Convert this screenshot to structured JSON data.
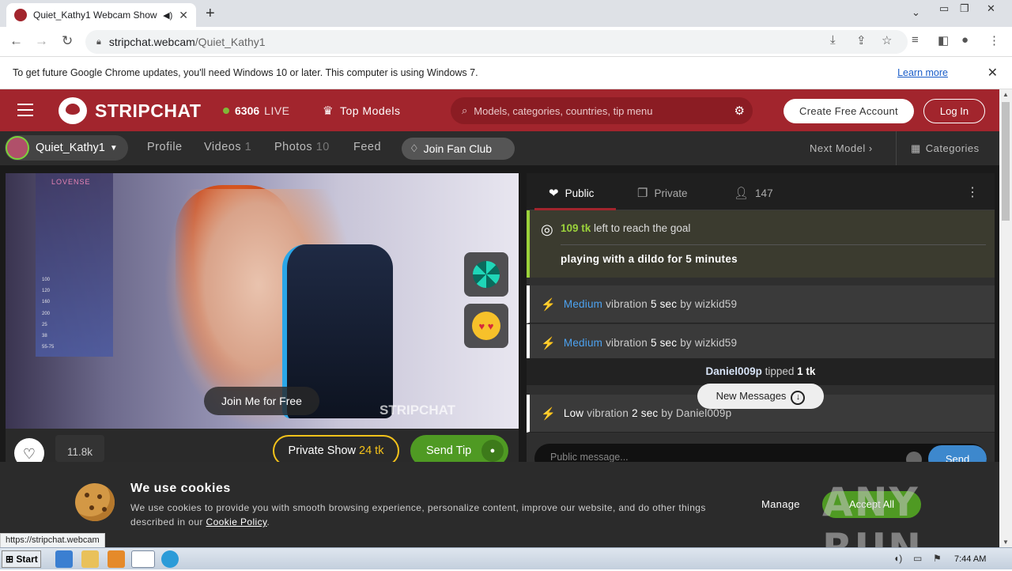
{
  "browser": {
    "tab_title": "Quiet_Kathy1 Webcam Show | ",
    "tab_close": "✕",
    "new_tab": "+",
    "url_host": "stripchat.webcam",
    "url_path": "/Quiet_Kathy1",
    "infobar_text": "To get future Google Chrome updates, you'll need Windows 10 or later. This computer is using Windows 7.",
    "infobar_link": "Learn more",
    "status_url": "https://stripchat.webcam"
  },
  "header": {
    "logo_text": "STRIPCHAT",
    "live_count": "6306",
    "live_label": "LIVE",
    "top_models": "Top Models",
    "search_placeholder": "Models, categories, countries, tip menu",
    "create_account": "Create Free Account",
    "login": "Log In"
  },
  "model_nav": {
    "model_name": "Quiet_Kathy1",
    "profile": "Profile",
    "videos": "Videos",
    "videos_count": "1",
    "photos": "Photos",
    "photos_count": "10",
    "feed": "Feed",
    "fan_club": "Join Fan Club",
    "next_model": "Next Model",
    "categories": "Categories"
  },
  "video": {
    "overlay_brand": "LOVENSE",
    "join_free": "Join Me for Free",
    "watermark": "STRIPCHAT",
    "like_count": "11.8k",
    "private_show": "Private Show",
    "private_price": "24 tk",
    "send_tip": "Send Tip"
  },
  "chat": {
    "tab_public": "Public",
    "tab_private": "Private",
    "users_count": "147",
    "goal_amount": "109 tk",
    "goal_text": "left to reach the goal",
    "goal_title": "playing with a dildo for 5 minutes",
    "messages": [
      {
        "level": "Medium",
        "action": "vibration",
        "duration": "5 sec",
        "by": "by wizkid59"
      },
      {
        "level": "Medium",
        "action": "vibration",
        "duration": "5 sec",
        "by": "by wizkid59"
      },
      {
        "level": "Low",
        "action": "vibration",
        "duration": "2 sec",
        "by": "by Daniel009p"
      }
    ],
    "tip_user": "Daniel009p",
    "tip_text": "tipped",
    "tip_amount": "1 tk",
    "new_messages": "New Messages",
    "input_placeholder": "Public message...",
    "send": "Send"
  },
  "cookie": {
    "title": "We use cookies",
    "text": "We use cookies to provide you with smooth browsing experience, personalize content, improve our website, and do other things described in our",
    "policy_link": "Cookie Policy",
    "manage": "Manage",
    "accept": "Accept All"
  },
  "watermark_overlay": "ANY RUN",
  "taskbar": {
    "start": "Start",
    "time": "7:44 AM"
  },
  "colors": {
    "brand_red": "#a2252d",
    "live_green": "#7bd23b",
    "tip_green": "#4f9a23",
    "link_blue": "#4ca2f0"
  }
}
